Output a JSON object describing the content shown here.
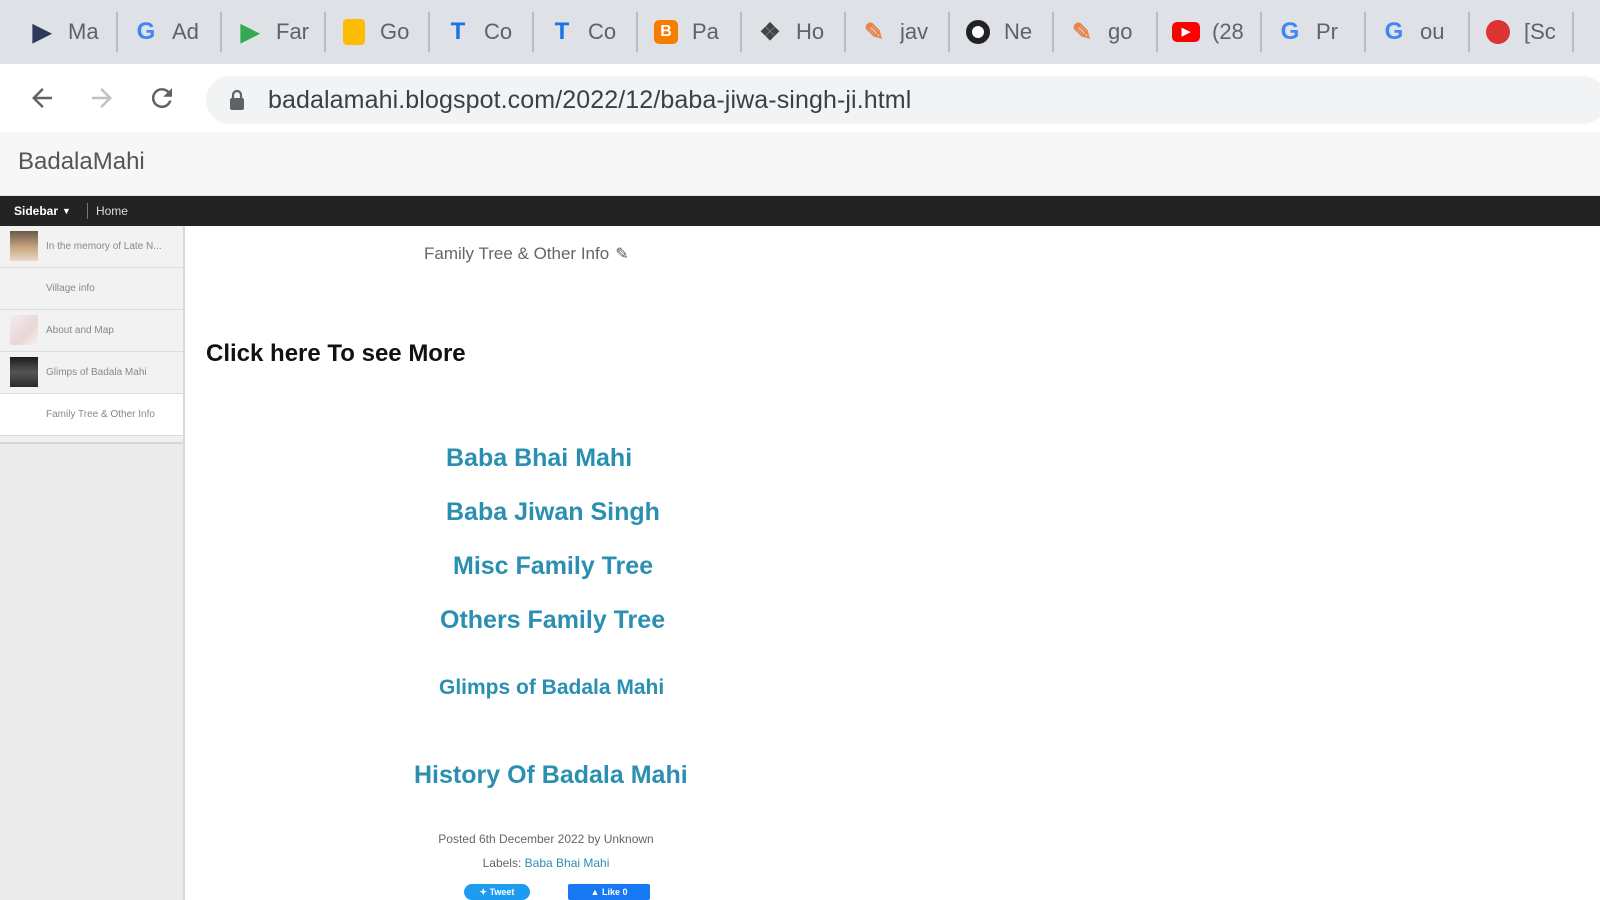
{
  "browser": {
    "tabs": [
      {
        "title": "Ma",
        "icon": "play-store-flag-icon",
        "color": "#2d3a5a"
      },
      {
        "title": "Ad",
        "icon": "google-icon",
        "color": "#4285f4"
      },
      {
        "title": "Far",
        "icon": "google-play-icon",
        "color": "#34a853"
      },
      {
        "title": "Go",
        "icon": "keep-icon",
        "color": "#fbbc04"
      },
      {
        "title": "Co",
        "icon": "t-icon",
        "color": "#1a73e8"
      },
      {
        "title": "Co",
        "icon": "t-icon",
        "color": "#1a73e8"
      },
      {
        "title": "Pa",
        "icon": "blogger-icon",
        "color": "#f57d00"
      },
      {
        "title": "Ho",
        "icon": "settings-diamond-icon",
        "color": "#444"
      },
      {
        "title": "jav",
        "icon": "edit-hand-icon",
        "color": "#e8834a"
      },
      {
        "title": "Ne",
        "icon": "chrome-icon",
        "color": "#222"
      },
      {
        "title": "go",
        "icon": "edit-hand-icon",
        "color": "#e8834a"
      },
      {
        "title": "(28",
        "icon": "youtube-icon",
        "color": "#ff0000"
      },
      {
        "title": "Pr",
        "icon": "google-icon",
        "color": "#4285f4"
      },
      {
        "title": "ou",
        "icon": "google-icon",
        "color": "#4285f4"
      },
      {
        "title": "[Sc",
        "icon": "bug-icon",
        "color": "#d33"
      }
    ],
    "url": "badalamahi.blogspot.com/2022/12/baba-jiwa-singh-ji.html"
  },
  "blog": {
    "title": "BadalaMahi"
  },
  "menu": {
    "sidebar_label": "Sidebar",
    "home_label": "Home"
  },
  "sidebar": {
    "items": [
      {
        "label": "In the memory of Late N...",
        "thumb": "photo"
      },
      {
        "label": "Village info",
        "thumb": ""
      },
      {
        "label": "About and Map",
        "thumb": "map"
      },
      {
        "label": "Glimps of Badala Mahi",
        "thumb": "photo"
      },
      {
        "label": "Family Tree & Other Info",
        "thumb": ""
      }
    ]
  },
  "post": {
    "title": "Family Tree & Other Info",
    "click_more": "Click here To see More",
    "links": [
      "Baba Bhai Mahi",
      "Baba Jiwan Singh",
      "Misc Family Tree",
      "Others Family Tree",
      "Glimps of Badala Mahi",
      "History Of Badala Mahi"
    ],
    "posted": "Posted 6th December 2022 by Unknown",
    "labels_prefix": "Labels:",
    "labels_value": "Baba Bhai Mahi",
    "tweet_label": "Tweet",
    "like_label": "Like 0"
  }
}
